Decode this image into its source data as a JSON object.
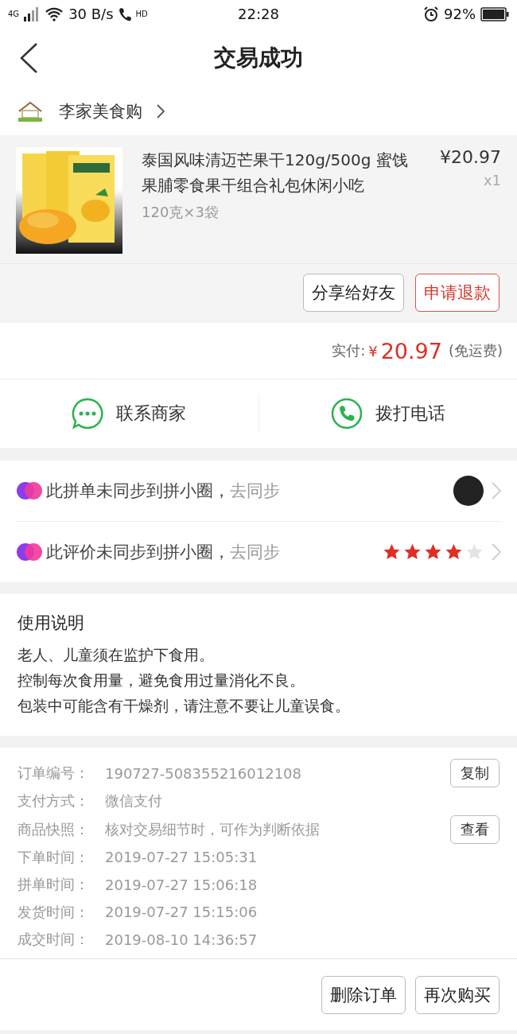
{
  "status_bar": {
    "network": "4G",
    "speed": "30 B/s",
    "hd": "HD",
    "time": "22:28",
    "battery": "92%"
  },
  "header": {
    "title": "交易成功"
  },
  "store": {
    "name": "李家美食购"
  },
  "product": {
    "title": "泰国风味清迈芒果干120g/500g 蜜饯果脯零食果干组合礼包休闲小吃",
    "spec": "120克×3袋",
    "price": "¥20.97",
    "quantity": "x1"
  },
  "product_actions": [
    {
      "label": "分享给好友",
      "kind": "normal"
    },
    {
      "label": "申请退款",
      "kind": "accent"
    }
  ],
  "payment": {
    "label": "实付:",
    "currency": "¥",
    "amount": "20.97",
    "note": "(免运费)"
  },
  "contact": [
    {
      "label": "联系商家",
      "kind": "chat"
    },
    {
      "label": "拨打电话",
      "kind": "phone"
    }
  ],
  "sync_rows": [
    {
      "text": "此拼单未同步到拼小圈，",
      "action": "去同步",
      "kind": "avatar"
    },
    {
      "text": "此评价未同步到拼小圈，",
      "action": "去同步",
      "kind": "rating",
      "stars": 4
    }
  ],
  "usage": {
    "title": "使用说明",
    "lines": [
      "老人、儿童须在监护下食用。",
      "控制每次食用量，避免食用过量消化不良。",
      "包装中可能含有干燥剂，请注意不要让儿童误食。"
    ]
  },
  "order_info": [
    {
      "label": "订单编号：",
      "value": "190727-508355216012108",
      "button": "复制"
    },
    {
      "label": "支付方式：",
      "value": "微信支付"
    },
    {
      "label": "商品快照：",
      "value": "核对交易细节时，可作为判断依据",
      "button": "查看"
    },
    {
      "label": "下单时间：",
      "value": "2019-07-27 15:05:31"
    },
    {
      "label": "拼单时间：",
      "value": "2019-07-27 15:06:18"
    },
    {
      "label": "发货时间：",
      "value": "2019-07-27 15:15:06"
    },
    {
      "label": "成交时间：",
      "value": "2019-08-10 14:36:57"
    }
  ],
  "bottom_actions": [
    "删除订单",
    "再次购买"
  ]
}
